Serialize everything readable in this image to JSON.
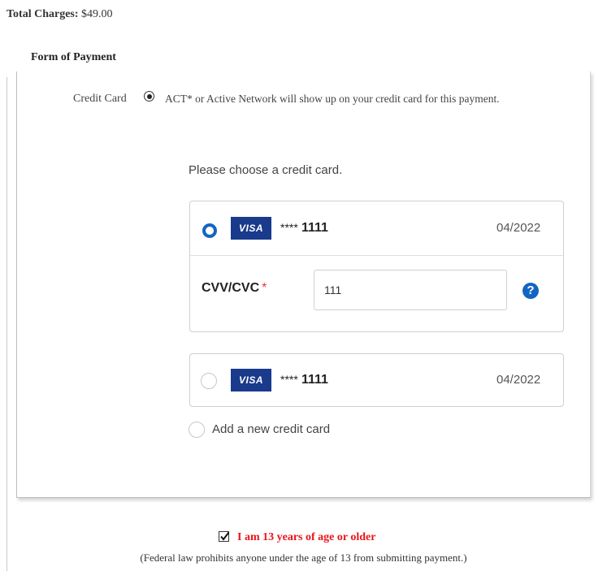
{
  "total": {
    "label": "Total Charges:",
    "amount": "$49.00"
  },
  "form_of_payment": {
    "title": "Form of Payment",
    "credit_card_label": "Credit Card",
    "credit_card_note": "ACT* or Active Network will show up on your credit card for this payment.",
    "choose_prompt": "Please choose a credit card.",
    "cards": [
      {
        "brand": "VISA",
        "stars": "****",
        "last4": "1111",
        "expiry": "04/2022",
        "selected": true
      },
      {
        "brand": "VISA",
        "stars": "****",
        "last4": "1111",
        "expiry": "04/2022",
        "selected": false
      }
    ],
    "cvv": {
      "label": "CVV/CVC",
      "required_mark": "*",
      "value": "111",
      "help_glyph": "?"
    },
    "add_new_label": "Add a new credit card"
  },
  "age_confirmation": {
    "checked": true,
    "label": "I am 13 years of age or older",
    "note": "(Federal law prohibits anyone under the age of 13 from submitting payment.)"
  },
  "colors": {
    "accent": "#1565c0",
    "visa_bg": "#1a3a8c",
    "warning": "#e8161b"
  },
  "icons": {
    "help": "question-circle-icon",
    "check": "check-icon"
  }
}
